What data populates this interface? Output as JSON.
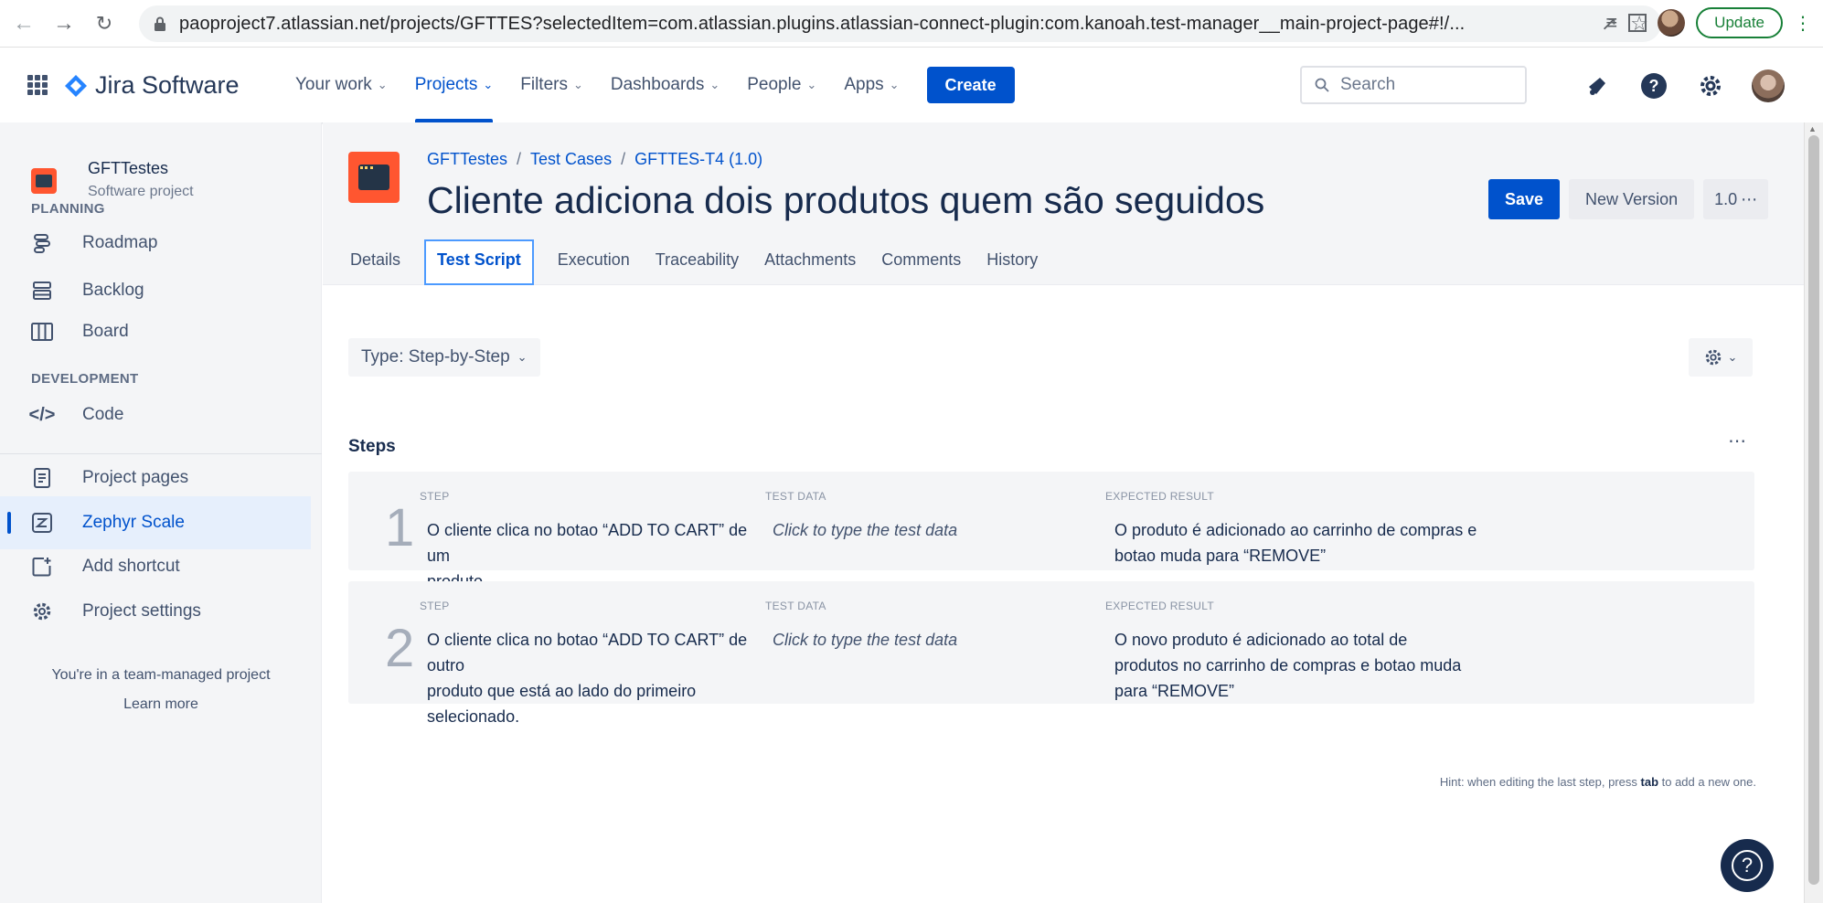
{
  "browser": {
    "url": "paoproject7.atlassian.net/projects/GFTTES?selectedItem=com.atlassian.plugins.atlassian-connect-plugin:com.kanoah.test-manager__main-project-page#!/...",
    "update_label": "Update"
  },
  "topnav": {
    "product_name": "Jira Software",
    "items": [
      {
        "label": "Your work"
      },
      {
        "label": "Projects"
      },
      {
        "label": "Filters"
      },
      {
        "label": "Dashboards"
      },
      {
        "label": "People"
      },
      {
        "label": "Apps"
      }
    ],
    "create_label": "Create",
    "search_placeholder": "Search"
  },
  "sidebar": {
    "project_name": "GFTTestes",
    "project_type": "Software project",
    "planning_label": "PLANNING",
    "development_label": "DEVELOPMENT",
    "items": [
      {
        "label": "Roadmap",
        "icon": "roadmap-icon"
      },
      {
        "label": "Backlog",
        "icon": "backlog-icon"
      },
      {
        "label": "Board",
        "icon": "board-icon"
      },
      {
        "label": "Code",
        "icon": "code-icon"
      },
      {
        "label": "Project pages",
        "icon": "pages-icon"
      },
      {
        "label": "Zephyr Scale",
        "icon": "zephyr-icon"
      },
      {
        "label": "Add shortcut",
        "icon": "add-shortcut-icon"
      },
      {
        "label": "Project settings",
        "icon": "settings-icon"
      }
    ],
    "footer_text": "You're in a team-managed project",
    "footer_link": "Learn more"
  },
  "issue": {
    "breadcrumb": [
      "GFTTestes",
      "Test Cases",
      "GFTTES-T4 (1.0)"
    ],
    "title": "Cliente adiciona dois produtos quem são seguidos",
    "save_label": "Save",
    "new_version_label": "New Version",
    "version_label": "1.0",
    "tabs": [
      {
        "label": "Details"
      },
      {
        "label": "Test Script"
      },
      {
        "label": "Execution"
      },
      {
        "label": "Traceability"
      },
      {
        "label": "Attachments"
      },
      {
        "label": "Comments"
      },
      {
        "label": "History"
      }
    ],
    "type_select": "Type: Step-by-Step"
  },
  "steps": {
    "title": "Steps",
    "col_step": "STEP",
    "col_test_data": "TEST DATA",
    "col_expected": "EXPECTED RESULT",
    "rows": [
      {
        "num": "1",
        "step_lines": [
          "O cliente clica no botao “ADD TO CART” de um",
          "produto."
        ],
        "test_data": "Click to type the test data",
        "expected_lines": [
          "O produto é adicionado ao carrinho de compras e",
          "botao muda para “REMOVE”"
        ]
      },
      {
        "num": "2",
        "step_lines": [
          "O cliente clica no botao “ADD TO CART” de outro",
          "produto que está ao lado do primeiro",
          "selecionado."
        ],
        "test_data": "Click to type the test data",
        "expected_lines": [
          "O novo produto é adicionado ao total de",
          "produtos no carrinho de compras e botao muda",
          "para “REMOVE”"
        ]
      }
    ],
    "hint_prefix": "Hint: when editing the last step, press ",
    "hint_key": "tab",
    "hint_suffix": " to add a new one."
  },
  "colors": {
    "brand_blue": "#0052cc",
    "project_orange": "#ff5630"
  }
}
